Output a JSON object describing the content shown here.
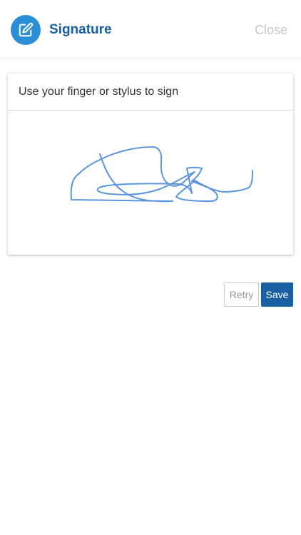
{
  "header": {
    "title": "Signature",
    "close_label": "Close",
    "icon": "edit-icon",
    "accent_color": "#2a8fd6",
    "title_color": "#1b5fa3"
  },
  "signature_card": {
    "instruction": "Use your finger or stylus to sign",
    "stroke_color": "#5b95e0"
  },
  "actions": {
    "retry_label": "Retry",
    "save_label": "Save",
    "save_color": "#1b5fa3"
  }
}
